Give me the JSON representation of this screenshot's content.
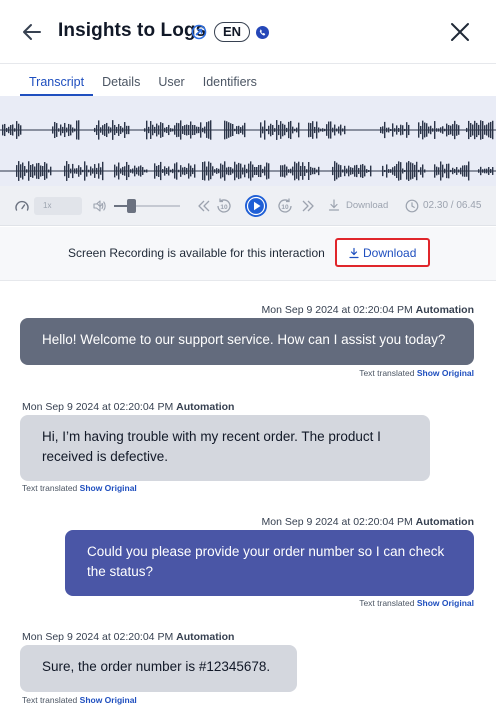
{
  "header": {
    "title": "Insights to Logs",
    "language_badge": "EN"
  },
  "tabs": [
    {
      "label": "Transcript",
      "active": true
    },
    {
      "label": "Details",
      "active": false
    },
    {
      "label": "User",
      "active": false
    },
    {
      "label": "Identifiers",
      "active": false
    }
  ],
  "player": {
    "speed": "1x",
    "volume": 0.25,
    "rewind_seconds": "10",
    "forward_seconds": "10",
    "download_label": "Download",
    "time": "02.30 / 06.45"
  },
  "recording": {
    "text": "Screen Recording is available for this interaction",
    "download_label": "Download"
  },
  "messages": [
    {
      "timestamp": "Mon Sep 9 2024 at 02:20:04 PM",
      "sender": "Automation",
      "text": "Hello! Welcome to our support service. How can I assist you today?",
      "translated_note": "Text translated",
      "show_original": "Show Original"
    },
    {
      "timestamp": "Mon Sep 9 2024 at 02:20:04 PM",
      "sender": "Automation",
      "text": "Hi, I’m having trouble with my recent order. The product I received is defective.",
      "translated_note": "Text translated",
      "show_original": "Show Original"
    },
    {
      "timestamp": "Mon Sep 9 2024 at 02:20:04 PM",
      "sender": "Automation",
      "text": "Could you please provide your order number so I can check the status?",
      "translated_note": "Text translated",
      "show_original": "Show Original"
    },
    {
      "timestamp": "Mon Sep 9 2024 at 02:20:04 PM",
      "sender": "Automation",
      "text": "Sure, the order number is #12345678.",
      "translated_note": "Text translated",
      "show_original": "Show Original"
    }
  ],
  "colors": {
    "accent": "#1f4fbf",
    "agent_bubble": "#636b7d",
    "agent_bubble_2": "#4a56a6",
    "customer_bubble": "#d4d7de",
    "highlight_border": "#e0262b",
    "waveform": "#2b3448"
  },
  "icons": {
    "back": "arrow-left-icon",
    "close": "close-icon",
    "link": "external-link-icon",
    "channel": "phone-icon",
    "speed_dial": "gauge-icon",
    "volume": "speaker-icon",
    "rewind": "rewind-10-icon",
    "play": "play-icon",
    "forward": "forward-10-icon",
    "download": "download-icon",
    "clock": "clock-icon"
  }
}
